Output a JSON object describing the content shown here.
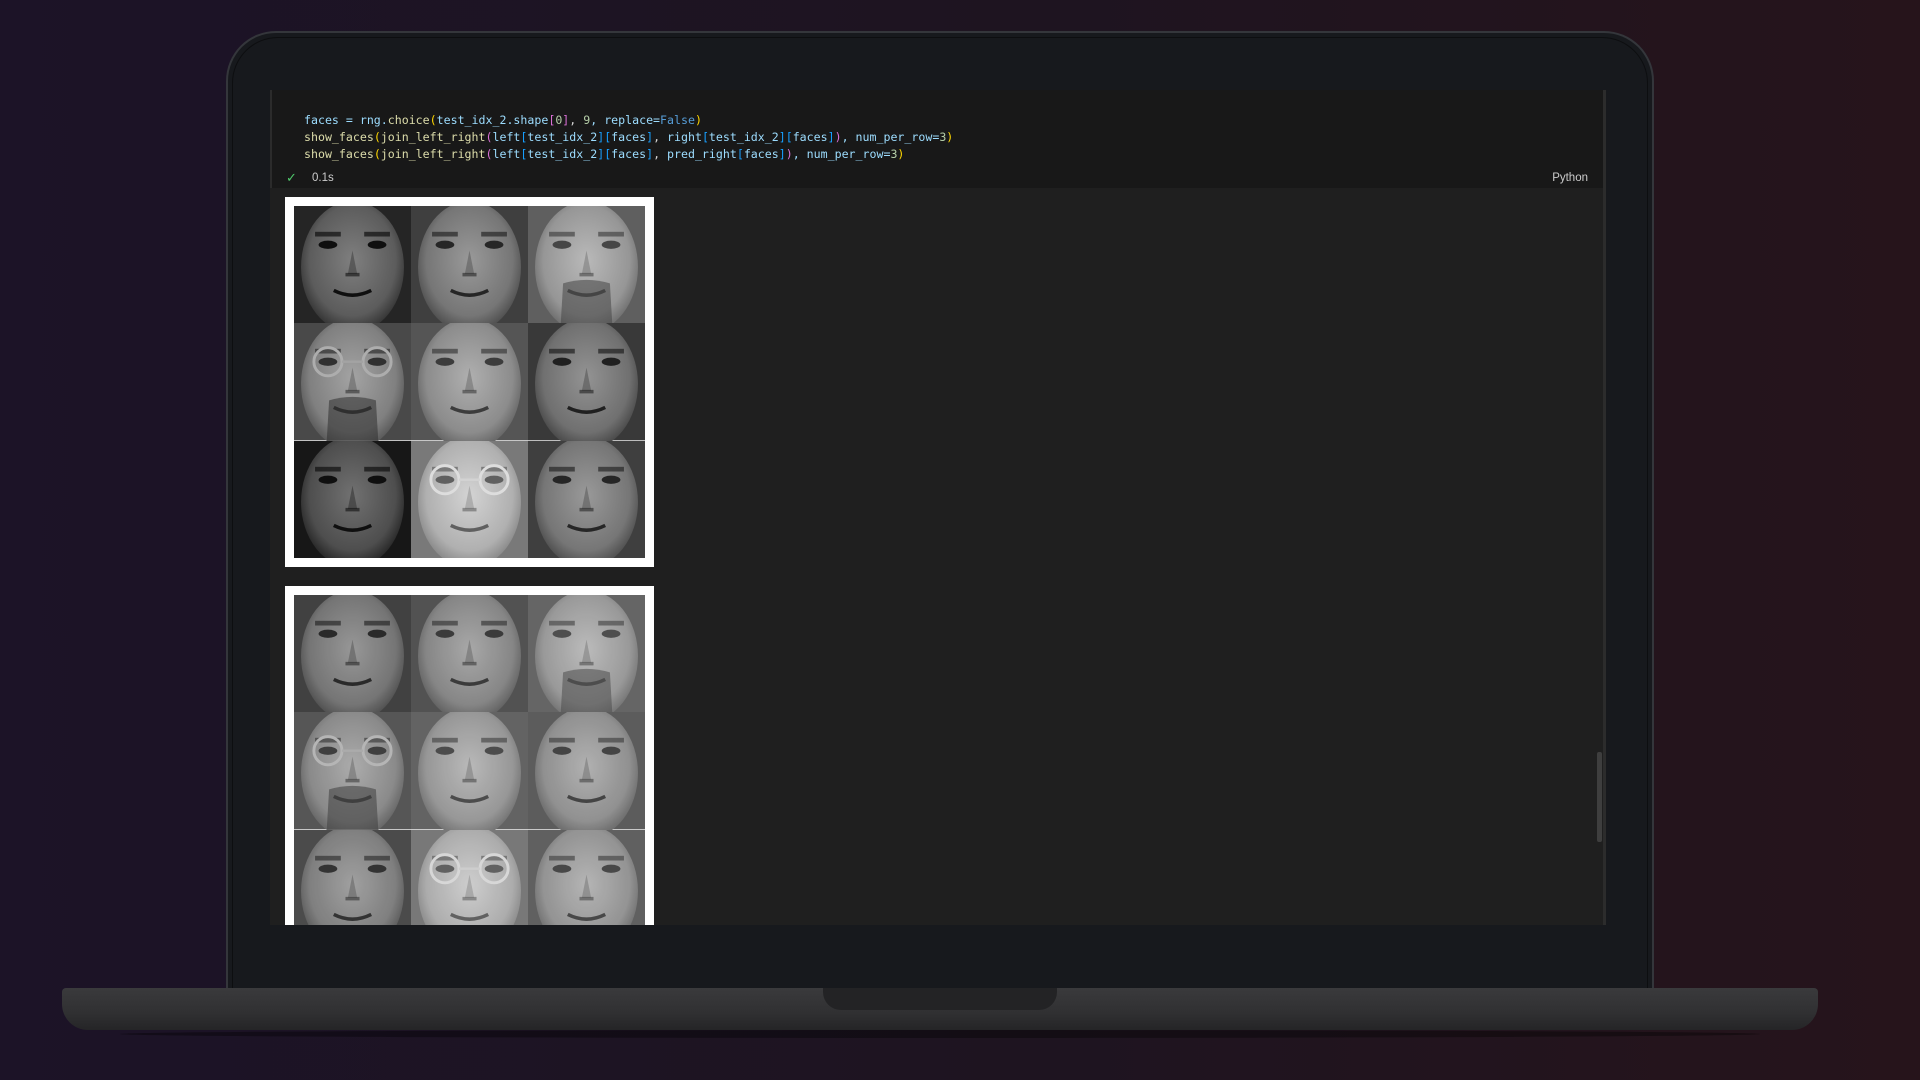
{
  "notebook": {
    "code_lines": [
      {
        "segments": [
          {
            "t": "faces = ",
            "c": "var"
          },
          {
            "t": "rng.",
            "c": "var"
          },
          {
            "t": "choice",
            "c": "fn"
          },
          {
            "t": "(",
            "c": "p1"
          },
          {
            "t": "test_idx_2.shape",
            "c": "var"
          },
          {
            "t": "[",
            "c": "p2"
          },
          {
            "t": "0",
            "c": "num"
          },
          {
            "t": "]",
            "c": "p2"
          },
          {
            "t": ", ",
            "c": ""
          },
          {
            "t": "9",
            "c": "num"
          },
          {
            "t": ", replace=",
            "c": "var"
          },
          {
            "t": "False",
            "c": "kw"
          },
          {
            "t": ")",
            "c": "p1"
          }
        ]
      },
      {
        "segments": [
          {
            "t": "show_faces",
            "c": "fn"
          },
          {
            "t": "(",
            "c": "p1"
          },
          {
            "t": "join_left_right",
            "c": "fn"
          },
          {
            "t": "(",
            "c": "p2"
          },
          {
            "t": "left",
            "c": "var"
          },
          {
            "t": "[",
            "c": "p3"
          },
          {
            "t": "test_idx_2",
            "c": "var"
          },
          {
            "t": "]",
            "c": "p3"
          },
          {
            "t": "[",
            "c": "p3"
          },
          {
            "t": "faces",
            "c": "var"
          },
          {
            "t": "]",
            "c": "p3"
          },
          {
            "t": ", ",
            "c": ""
          },
          {
            "t": "right",
            "c": "var"
          },
          {
            "t": "[",
            "c": "p3"
          },
          {
            "t": "test_idx_2",
            "c": "var"
          },
          {
            "t": "]",
            "c": "p3"
          },
          {
            "t": "[",
            "c": "p3"
          },
          {
            "t": "faces",
            "c": "var"
          },
          {
            "t": "]",
            "c": "p3"
          },
          {
            "t": ")",
            "c": "p2"
          },
          {
            "t": ", num_per_row=",
            "c": "var"
          },
          {
            "t": "3",
            "c": "num"
          },
          {
            "t": ")",
            "c": "p1"
          }
        ]
      },
      {
        "segments": [
          {
            "t": "show_faces",
            "c": "fn"
          },
          {
            "t": "(",
            "c": "p1"
          },
          {
            "t": "join_left_right",
            "c": "fn"
          },
          {
            "t": "(",
            "c": "p2"
          },
          {
            "t": "left",
            "c": "var"
          },
          {
            "t": "[",
            "c": "p3"
          },
          {
            "t": "test_idx_2",
            "c": "var"
          },
          {
            "t": "]",
            "c": "p3"
          },
          {
            "t": "[",
            "c": "p3"
          },
          {
            "t": "faces",
            "c": "var"
          },
          {
            "t": "]",
            "c": "p3"
          },
          {
            "t": ", ",
            "c": ""
          },
          {
            "t": "pred_right",
            "c": "var"
          },
          {
            "t": "[",
            "c": "p3"
          },
          {
            "t": "faces",
            "c": "var"
          },
          {
            "t": "]",
            "c": "p3"
          },
          {
            "t": ")",
            "c": "p2"
          },
          {
            "t": ", num_per_row=",
            "c": "var"
          },
          {
            "t": "3",
            "c": "num"
          },
          {
            "t": ")",
            "c": "p1"
          }
        ]
      }
    ],
    "status": {
      "check_icon": "✓",
      "time": "0.1s"
    },
    "language": "Python"
  },
  "outputs": {
    "figure1": {
      "tones": [
        92,
        118,
        150,
        128,
        140,
        112,
        78,
        176,
        118
      ]
    },
    "figure2": {
      "tones": [
        110,
        128,
        148,
        132,
        146,
        138,
        120,
        168,
        142
      ]
    }
  }
}
